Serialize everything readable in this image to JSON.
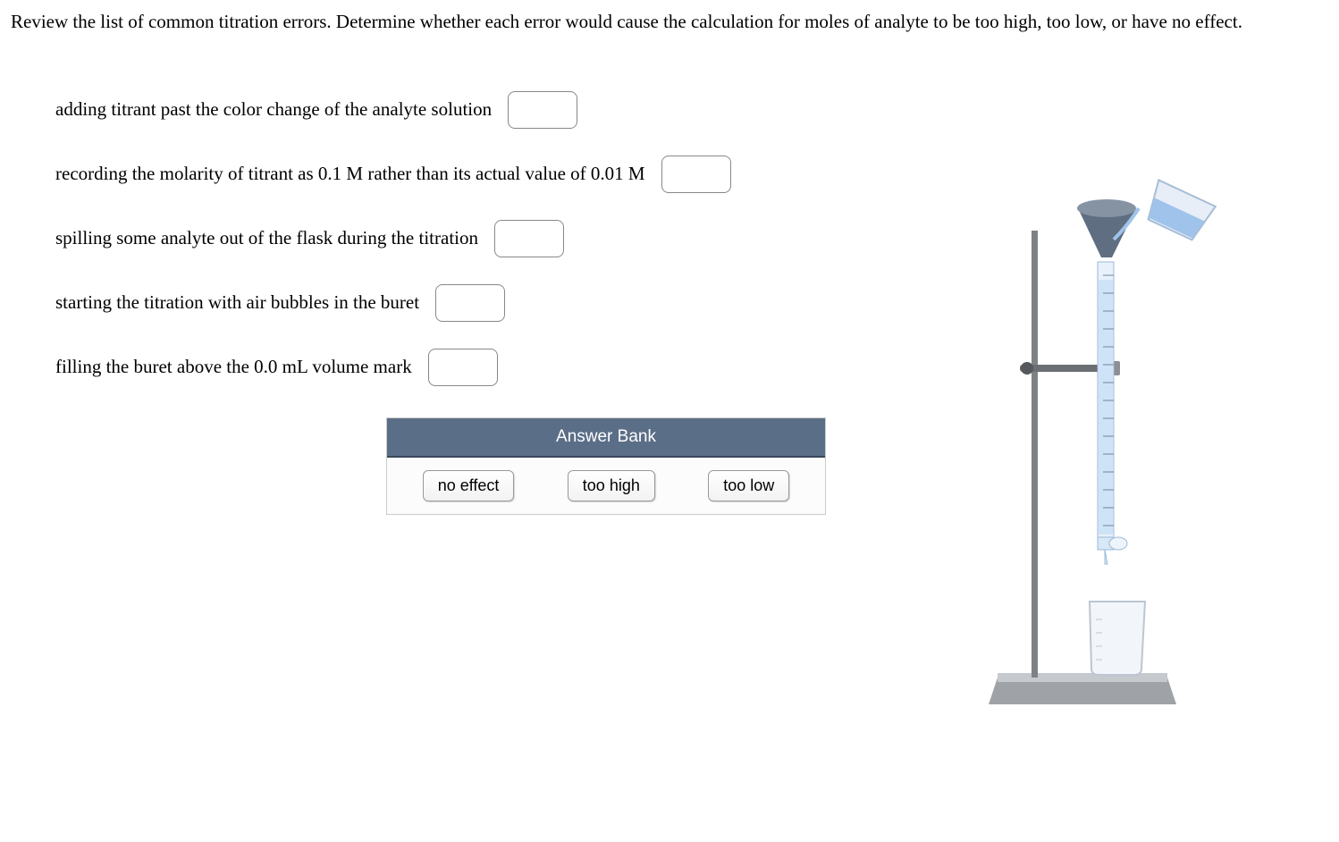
{
  "question": "Review the list of common titration errors. Determine whether each error would cause the calculation for moles of analyte to be too high, too low, or have no effect.",
  "rows": [
    "adding titrant past the color change of the analyte solution",
    "recording the molarity of titrant as 0.1 M rather than its actual value of 0.01 M",
    "spilling some analyte out of the flask during the titration",
    "starting the titration with air bubbles in the buret",
    "filling the buret above the 0.0 mL volume mark"
  ],
  "answer_bank": {
    "title": "Answer Bank",
    "options": [
      "no effect",
      "too high",
      "too low"
    ]
  },
  "image_alt": "titration-apparatus"
}
